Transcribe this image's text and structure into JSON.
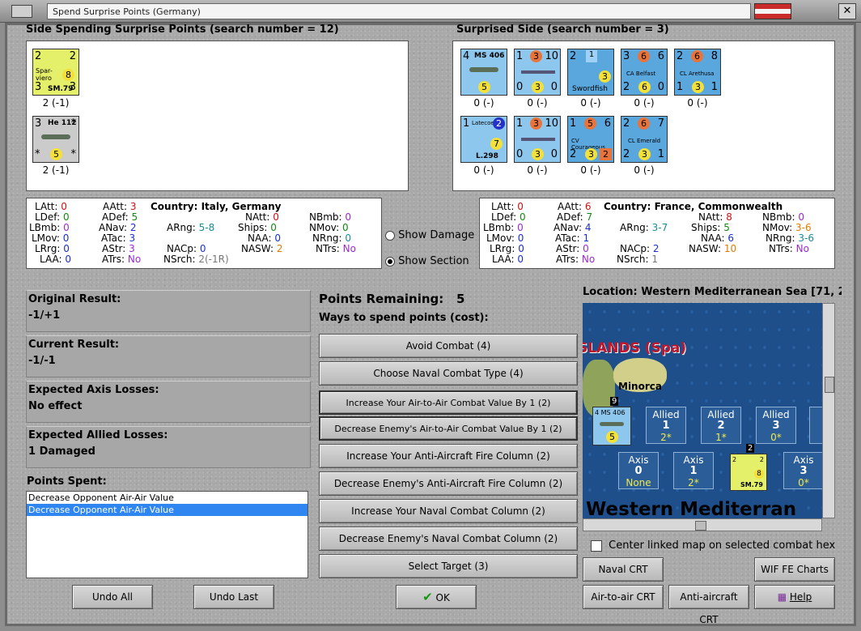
{
  "window": {
    "title": "Spend Surprise Points (Germany)"
  },
  "spending_side": {
    "heading": "Side Spending Surprise Points (search number = 12)",
    "units": [
      {
        "name": "SM.79",
        "label": "2 (-1)",
        "top_left": "2",
        "top_right": "2",
        "left": "Spar-viero",
        "right_circle": "8",
        "bottom_left": "3",
        "bottom_right": "3"
      },
      {
        "name": "He 112",
        "label": "2 (-1)",
        "top_left": "3",
        "top_right": "*",
        "bottom_circle": "5",
        "bottom_left": "*",
        "bottom_right": "*"
      }
    ]
  },
  "surprised_side": {
    "heading": "Surprised Side (search number = 3)",
    "units_row1": [
      {
        "name": "MS 406",
        "label": "0 (-)",
        "top_left": "4",
        "circle": "5"
      },
      {
        "name": "ship",
        "label": "0 (-)",
        "top": "1 3 10",
        "bottom": "0 3 0"
      },
      {
        "name": "Swordfish",
        "label": "0 (-)",
        "top": "2 1",
        "circle": "3"
      },
      {
        "name": "CA Belfast",
        "label": "0 (-)",
        "top": "3 6 6",
        "bottom": "2 6 0"
      },
      {
        "name": "CL Arethusa",
        "label": "0 (-)",
        "top": "2 6 8",
        "bottom": "1 3 1"
      }
    ],
    "units_row2": [
      {
        "name": "Latecoere L.298",
        "label": "0 (-)",
        "top": "1 2",
        "circle": "7"
      },
      {
        "name": "ship",
        "label": "0 (-)",
        "top": "1 3 10",
        "bottom": "0 3 0"
      },
      {
        "name": "CV Courageous",
        "label": "0 (-)",
        "top": "1 5 6",
        "bottom": "2 3 2"
      },
      {
        "name": "CL Emerald",
        "label": "0 (-)",
        "top": "2 6 7",
        "bottom": "2 3 1"
      }
    ]
  },
  "stats_left": {
    "country": "Country: Italy, Germany",
    "LAtt": "0",
    "LDef": "0",
    "LBmb": "0",
    "LMov": "0",
    "LRrg": "0",
    "LAA": "0",
    "AAtt": "3",
    "ADef": "5",
    "ANav": "2",
    "ATac": "3",
    "AStr": "3",
    "ATrs": "No",
    "ARng": "5-8",
    "NACp": "0",
    "NSrch": "2(-1R)",
    "NAtt": "0",
    "Ships": "0",
    "NAA": "0",
    "NASW": "2",
    "NBmb": "0",
    "NMov": "0",
    "NRng": "0",
    "NTrs": "No"
  },
  "stats_right": {
    "country": "Country: France, Commonwealth",
    "LAtt": "0",
    "LDef": "0",
    "LBmb": "0",
    "LMov": "0",
    "LRrg": "0",
    "LAA": "0",
    "AAtt": "6",
    "ADef": "7",
    "ANav": "4",
    "ATac": "1",
    "AStr": "0",
    "ATrs": "No",
    "ARng": "3-7",
    "NACp": "2",
    "NSrch": "1",
    "NAtt": "8",
    "Ships": "5",
    "NAA": "6",
    "NASW": "10",
    "NBmb": "0",
    "NMov": "3-6",
    "NRng": "3-6",
    "NTrs": "No"
  },
  "stat_labels": {
    "LAtt": "LAtt:",
    "LDef": "LDef:",
    "LBmb": "LBmb:",
    "LMov": "LMov:",
    "LRrg": "LRrg:",
    "LAA": "LAA:",
    "AAtt": "AAtt:",
    "ADef": "ADef:",
    "ANav": "ANav:",
    "ATac": "ATac:",
    "AStr": "AStr:",
    "ATrs": "ATrs:",
    "ARng": "ARng:",
    "NACp": "NACp:",
    "NSrch": "NSrch:",
    "NAtt": "NAtt:",
    "Ships": "Ships:",
    "NAA": "NAA:",
    "NASW": "NASW:",
    "NBmb": "NBmb:",
    "NMov": "NMov:",
    "NRng": "NRng:",
    "NTrs": "NTrs:"
  },
  "display_options": {
    "show_damage": "Show Damage",
    "show_section": "Show Section"
  },
  "results": {
    "original_label": "Original Result:",
    "original_value": "-1/+1",
    "current_label": "Current Result:",
    "current_value": "-1/-1",
    "axis_label": "Expected Axis Losses:",
    "axis_value": "No effect",
    "allied_label": "Expected Allied Losses:",
    "allied_value": "1 Damaged"
  },
  "points_spent": {
    "label": "Points Spent:",
    "items": [
      "Decrease Opponent Air-Air Value",
      "Decrease Opponent Air-Air Value"
    ]
  },
  "points": {
    "remaining_label": "Points Remaining:",
    "remaining_value": "5",
    "ways_label": "Ways to spend points (cost):"
  },
  "spend_options": [
    "Avoid Combat (4)",
    "Choose Naval Combat Type (4)",
    "Increase Your Air-to-Air Combat Value By 1 (2)",
    "Decrease Enemy's Air-to-Air Combat Value By 1 (2)",
    "Increase Your Anti-Aircraft Fire Column (2)",
    "Decrease Enemy's Anti-Aircraft Fire Column (2)",
    "Increase Your Naval Combat Column (2)",
    "Decrease Enemy's Naval Combat Column (2)",
    "Select Target (3)"
  ],
  "buttons": {
    "undo_all": "Undo All",
    "undo_last": "Undo Last",
    "ok": "OK",
    "naval_crt": "Naval CRT",
    "wif_fe_charts": "WIF FE Charts",
    "air_to_air_crt": "Air-to-air CRT",
    "anti_aircraft_crt": "Anti-aircraft CRT",
    "help": "Help"
  },
  "map": {
    "location": "Location: Western Mediterranean Sea [71, 2",
    "islands_label": "SLANDS (Spa)",
    "minorca": "Minorca",
    "sea_label": "Western Mediterran",
    "allied_boxes": [
      {
        "side": "Allied",
        "num": "1",
        "val": "2*"
      },
      {
        "side": "Allied",
        "num": "2",
        "val": "1*"
      },
      {
        "side": "Allied",
        "num": "3",
        "val": "0*"
      }
    ],
    "axis_boxes": [
      {
        "side": "Axis",
        "num": "0",
        "val": "None"
      },
      {
        "side": "Axis",
        "num": "1",
        "val": "2*"
      },
      {
        "side": "Axis",
        "num": "3",
        "val": "0*"
      }
    ],
    "stack_count_allied": "9",
    "stack_count_axis": "2",
    "center_checkbox": "Center linked map on selected combat hex"
  }
}
